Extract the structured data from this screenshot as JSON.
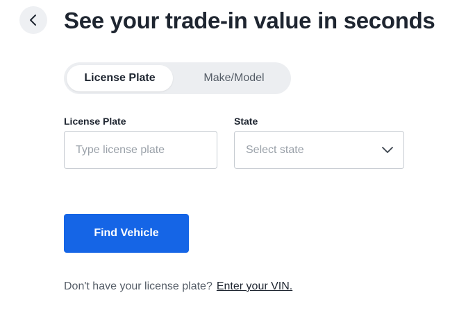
{
  "header": {
    "title": "See your trade-in value in seconds",
    "back_icon": "chevron-left-icon"
  },
  "tabs": [
    {
      "label": "License Plate",
      "active": true
    },
    {
      "label": "Make/Model",
      "active": false
    }
  ],
  "form": {
    "plate_label": "License Plate",
    "plate_placeholder": "Type license plate",
    "plate_value": "",
    "state_label": "State",
    "state_placeholder": "Select state",
    "state_icon": "chevron-down-icon"
  },
  "actions": {
    "find_label": "Find Vehicle"
  },
  "help": {
    "text": "Don't have your license plate?",
    "link": "Enter your VIN."
  },
  "colors": {
    "primary": "#1565e6",
    "text": "#1e2530",
    "muted": "#545c66"
  }
}
